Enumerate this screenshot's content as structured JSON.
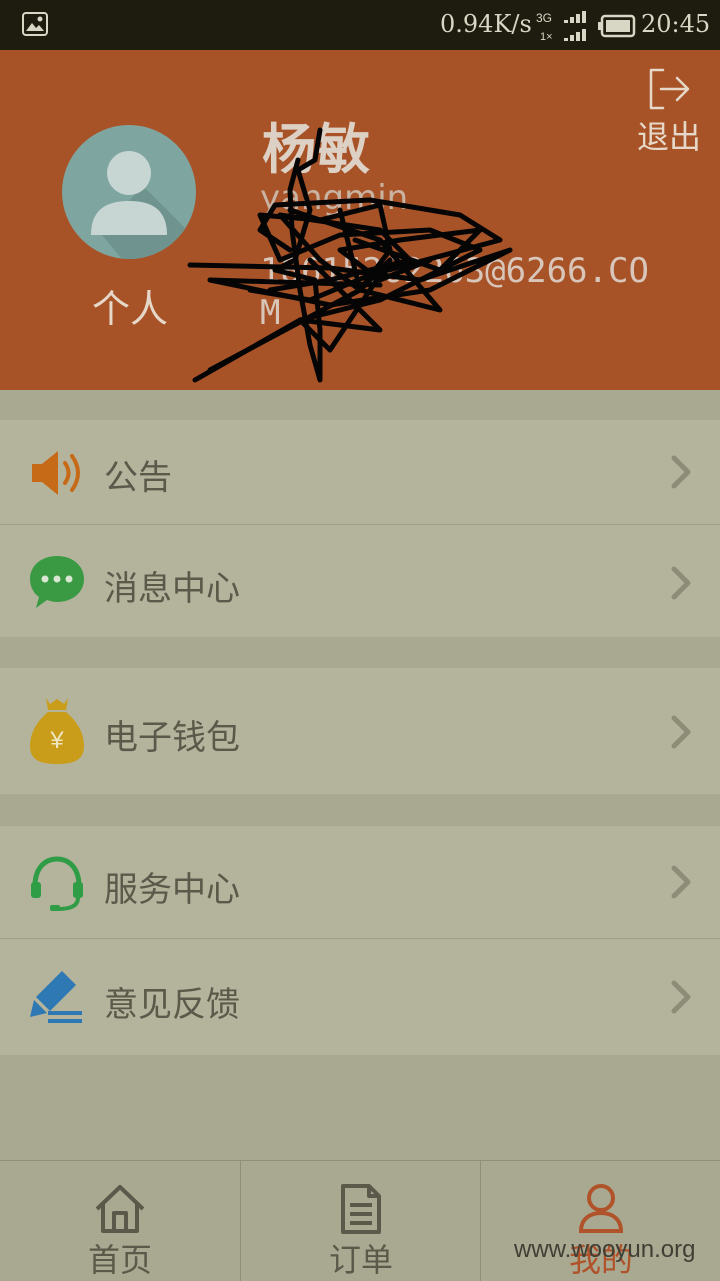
{
  "status_bar": {
    "speed": "0.94K/s",
    "network_top": "3G",
    "network_bottom": "1×",
    "time": "20:45"
  },
  "profile": {
    "avatar_label": "个人",
    "name": "杨敏",
    "user_id": "yangmin",
    "email": "18615262263@6266.COM",
    "logout_label": "退出"
  },
  "menu": {
    "announcement": "公告",
    "messages": "消息中心",
    "wallet": "电子钱包",
    "service": "服务中心",
    "feedback": "意见反馈"
  },
  "tabbar": {
    "home": "首页",
    "orders": "订单",
    "mine": "我的"
  },
  "watermark": "www.wooyun.org",
  "colors": {
    "header": "#a85327",
    "accent": "#b0522a",
    "menu_bg": "#b4b39c"
  }
}
